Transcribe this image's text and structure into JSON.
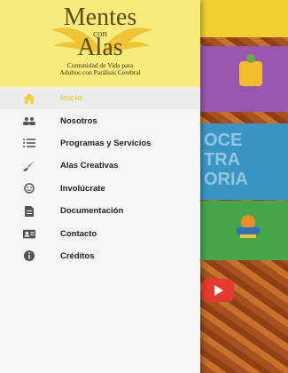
{
  "header": {
    "logo_line1": "Mentes",
    "logo_line2": "con",
    "logo_line3": "Alas",
    "tagline_line1": "Comunidad de Vida para",
    "tagline_line2": "Adultos con Parálisis Cerebral"
  },
  "menu": {
    "items": [
      {
        "label": "Inicio",
        "icon": "home-icon",
        "active": true
      },
      {
        "label": "Nosotros",
        "icon": "people-icon",
        "active": false
      },
      {
        "label": "Programas y Servicios",
        "icon": "list-icon",
        "active": false
      },
      {
        "label": "Alas Creativas",
        "icon": "brush-icon",
        "active": false
      },
      {
        "label": "Involúcrate",
        "icon": "smile-face-icon",
        "active": false
      },
      {
        "label": "Documentación",
        "icon": "document-icon",
        "active": false
      },
      {
        "label": "Contacto",
        "icon": "contact-card-icon",
        "active": false
      },
      {
        "label": "Créditos",
        "icon": "info-icon",
        "active": false
      }
    ]
  },
  "background": {
    "card_text_line1": "OCE",
    "card_text_line2": "TRA",
    "card_text_line3": "ORIA"
  },
  "colors": {
    "accent": "#f1d03a",
    "header_bg": "#f7ec7b",
    "drawer_bg": "#f6f6f6",
    "icon": "#555555"
  }
}
